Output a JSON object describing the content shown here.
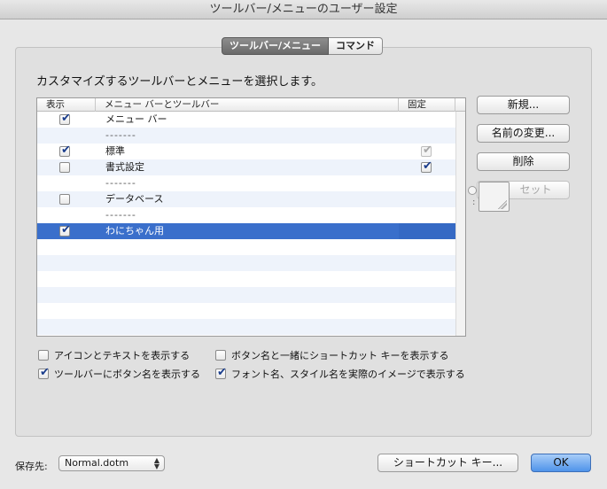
{
  "window": {
    "title": "ツールバー/メニューのユーザー設定"
  },
  "tabs": [
    {
      "label": "ツールバー/メニュー",
      "active": true
    },
    {
      "label": "コマンド",
      "active": false
    }
  ],
  "instruction": "カスタマイズするツールバーとメニューを選択します。",
  "list": {
    "columns": {
      "show": "表示",
      "name": "メニュー バーとツールバー",
      "fixed": "固定"
    },
    "rows": [
      {
        "name": "メニュー バー",
        "show": true,
        "fixed": null,
        "separator": false,
        "selected": false
      },
      {
        "name": "-------",
        "show": null,
        "fixed": null,
        "separator": true,
        "selected": false
      },
      {
        "name": "標準",
        "show": true,
        "fixed": "disabled-checked",
        "separator": false,
        "selected": false
      },
      {
        "name": "書式設定",
        "show": false,
        "fixed": "checked",
        "separator": false,
        "selected": false
      },
      {
        "name": "-------",
        "show": null,
        "fixed": null,
        "separator": true,
        "selected": false
      },
      {
        "name": "データベース",
        "show": false,
        "fixed": null,
        "separator": false,
        "selected": false
      },
      {
        "name": "-------",
        "show": null,
        "fixed": null,
        "separator": true,
        "selected": false
      },
      {
        "name": "わにちゃん用",
        "show": true,
        "fixed": null,
        "separator": false,
        "selected": true
      }
    ]
  },
  "buttons": {
    "new": "新規...",
    "rename": "名前の変更...",
    "delete": "削除",
    "reset": "セット",
    "shortcut": "ショートカット キー...",
    "ok": "OK"
  },
  "options": [
    {
      "label": "アイコンとテキストを表示する",
      "checked": false
    },
    {
      "label": "ボタン名と一緒にショートカット キーを表示する",
      "checked": false
    },
    {
      "label": "ツールバーにボタン名を表示する",
      "checked": true
    },
    {
      "label": "フォント名、スタイル名を実際のイメージで表示する",
      "checked": true
    }
  ],
  "footer": {
    "save_label": "保存先:",
    "save_value": "Normal.dotm"
  },
  "colors": {
    "selection": "#3a6fcb",
    "default_button": "#4f93ea",
    "check": "#1a3d8c"
  }
}
